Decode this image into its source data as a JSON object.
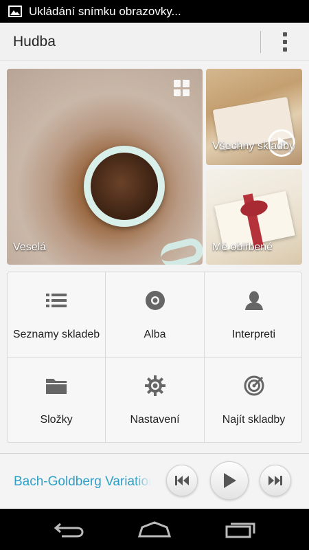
{
  "status_bar": {
    "notification_icon": "image-icon",
    "text": "Ukládání snímku obrazovky..."
  },
  "action_bar": {
    "title": "Hudba",
    "overflow_icon": "overflow-menu-icon"
  },
  "tiles": {
    "big": {
      "label": "Veselá",
      "icon": "grid-icon"
    },
    "top": {
      "label": "Všechny skladby",
      "icon": "play-circle-icon"
    },
    "bottom": {
      "label": "Mé oblíbené"
    }
  },
  "categories": [
    {
      "label": "Seznamy skladeb",
      "icon": "list-icon"
    },
    {
      "label": "Alba",
      "icon": "disc-icon"
    },
    {
      "label": "Interpreti",
      "icon": "person-icon"
    },
    {
      "label": "Složky",
      "icon": "folder-icon"
    },
    {
      "label": "Nastavení",
      "icon": "gear-icon"
    },
    {
      "label": "Najít skladby",
      "icon": "target-icon"
    }
  ],
  "player": {
    "track_title": "Bach-Goldberg Variations",
    "accent_color": "#2ea0c8"
  },
  "navbar": {
    "back_icon": "back-icon",
    "home_icon": "home-icon",
    "recents_icon": "recent-apps-icon"
  }
}
